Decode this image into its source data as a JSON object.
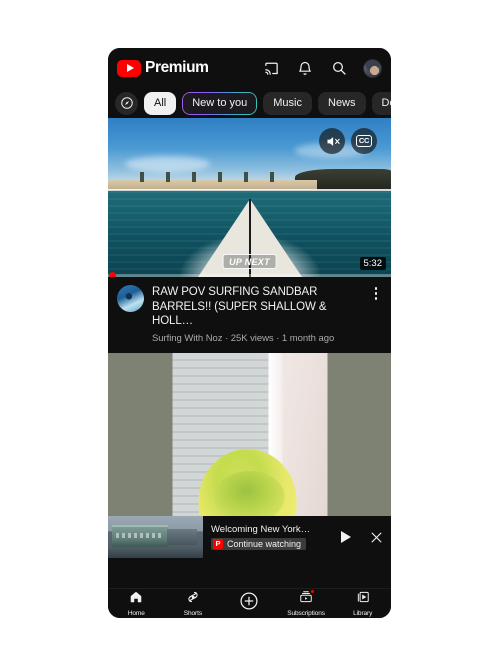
{
  "header": {
    "brand_label": "Premium",
    "icons": [
      {
        "name": "cast-icon",
        "label": "Cast"
      },
      {
        "name": "bell-icon",
        "label": "Notifications"
      },
      {
        "name": "search-icon",
        "label": "Search"
      },
      {
        "name": "avatar",
        "label": "Account"
      }
    ]
  },
  "chips": {
    "explore_label": "Explore",
    "items": [
      {
        "label": "All",
        "state": "active"
      },
      {
        "label": "New to you",
        "state": "gradient"
      },
      {
        "label": "Music",
        "state": "normal"
      },
      {
        "label": "News",
        "state": "normal"
      },
      {
        "label": "De",
        "state": "normal"
      }
    ]
  },
  "player": {
    "mute_icon": "volume-muted-icon",
    "cc_label": "CC",
    "up_next_label": "UP NEXT",
    "duration": "5:32"
  },
  "video": {
    "title": "RAW POV SURFING SANDBAR BARRELS!! (SUPER SHALLOW & HOLL…",
    "channel": "Surfing With Noz",
    "views": "25K views",
    "age": "1 month ago",
    "subtitle": "Surfing With Noz · 25K views · 1 month ago",
    "menu_label": "More actions"
  },
  "miniplayer": {
    "title": "Welcoming New York…",
    "badge_mark": "P",
    "badge_label": "Continue watching",
    "play_label": "Play",
    "close_label": "Close"
  },
  "navbar": {
    "items": [
      {
        "label": "Home",
        "icon": "home-icon",
        "badge": false
      },
      {
        "label": "Shorts",
        "icon": "shorts-icon",
        "badge": false
      },
      {
        "label": "",
        "icon": "create-plus-icon",
        "badge": false
      },
      {
        "label": "Subscriptions",
        "icon": "subscriptions-icon",
        "badge": true
      },
      {
        "label": "Library",
        "icon": "library-icon",
        "badge": false
      }
    ]
  }
}
